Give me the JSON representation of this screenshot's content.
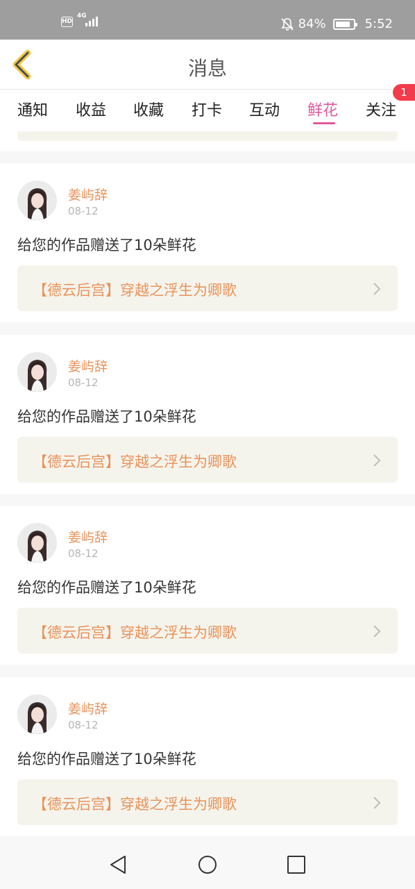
{
  "status_bar": {
    "hd": "HD",
    "network": "4G",
    "battery": "84%",
    "battery_level": 0.84,
    "time": "5:52"
  },
  "nav": {
    "title": "消息",
    "back_icon": "chevron-left-icon",
    "accent_color": "#f2c94c"
  },
  "tabs": [
    {
      "label": "通知"
    },
    {
      "label": "收益"
    },
    {
      "label": "收藏"
    },
    {
      "label": "打卡"
    },
    {
      "label": "互动"
    },
    {
      "label": "鲜花",
      "active": true
    },
    {
      "label": "关注",
      "badge": "1"
    }
  ],
  "colors": {
    "active_tab": "#e0589f",
    "username": "#e8935c",
    "badge": "#f23b4b",
    "link_bg": "#f5f4ec"
  },
  "messages": [
    {
      "username": "姜屿辞",
      "date": "08-12",
      "text": "给您的作品赠送了10朵鲜花",
      "work_title": "【德云后宫】穿越之浮生为卿歌"
    },
    {
      "username": "姜屿辞",
      "date": "08-12",
      "text": "给您的作品赠送了10朵鲜花",
      "work_title": "【德云后宫】穿越之浮生为卿歌"
    },
    {
      "username": "姜屿辞",
      "date": "08-12",
      "text": "给您的作品赠送了10朵鲜花",
      "work_title": "【德云后宫】穿越之浮生为卿歌"
    },
    {
      "username": "姜屿辞",
      "date": "08-12",
      "text": "给您的作品赠送了10朵鲜花",
      "work_title": "【德云后宫】穿越之浮生为卿歌"
    }
  ],
  "system_nav": [
    "back-triangle-icon",
    "home-circle-icon",
    "recents-square-icon"
  ]
}
